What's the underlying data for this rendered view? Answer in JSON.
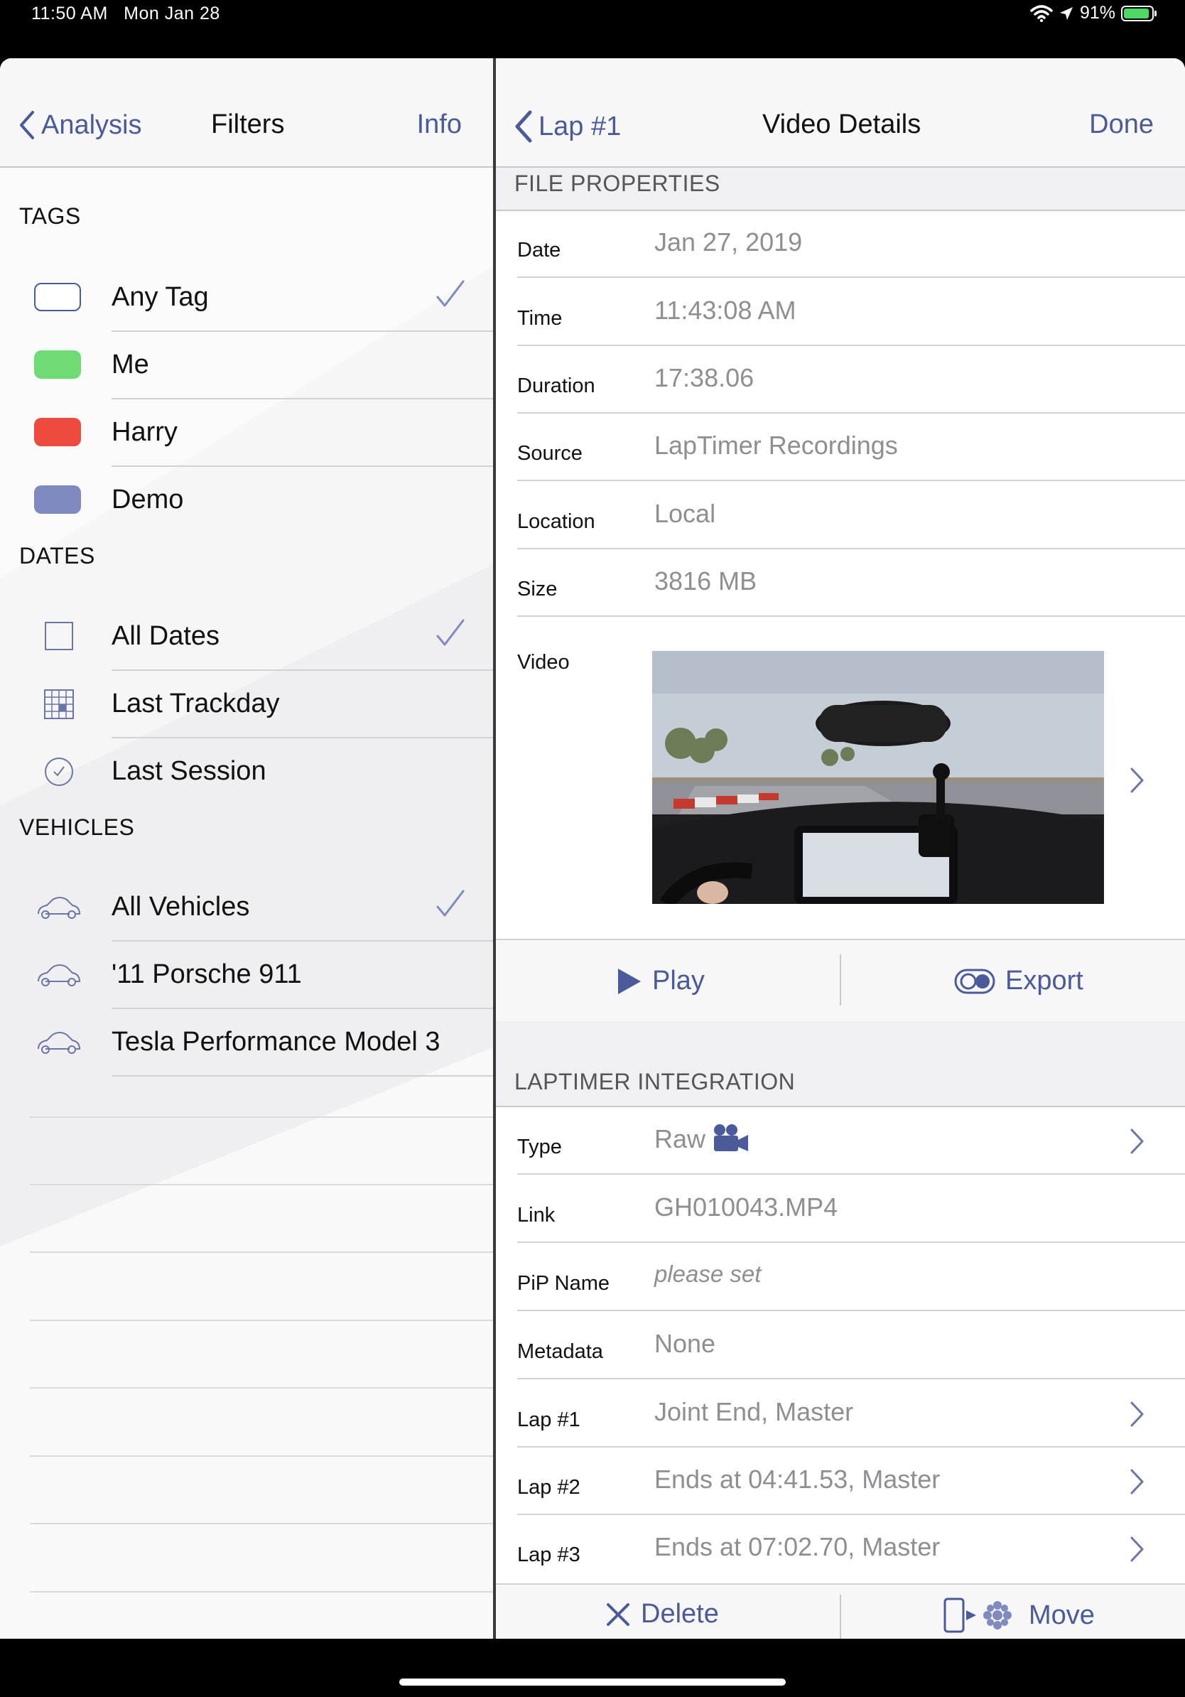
{
  "status_bar": {
    "time": "11:50 AM",
    "date": "Mon Jan 28",
    "battery": "91%",
    "battery_fraction": 0.91
  },
  "left": {
    "nav": {
      "back_label": "Analysis",
      "title": "Filters",
      "action_label": "Info"
    },
    "tags": {
      "header": "TAGS",
      "items": [
        {
          "label": "Any Tag",
          "swatch_color": "#ffffff",
          "checked": true
        },
        {
          "label": "Me",
          "swatch_color": "#6fdb75",
          "checked": false
        },
        {
          "label": "Harry",
          "swatch_color": "#ee4b3e",
          "checked": false
        },
        {
          "label": "Demo",
          "swatch_color": "#7f8bc0",
          "checked": false
        }
      ]
    },
    "dates": {
      "header": "DATES",
      "items": [
        {
          "label": "All Dates",
          "icon": "square-icon",
          "checked": true
        },
        {
          "label": "Last Trackday",
          "icon": "calendar-grid-icon",
          "checked": false
        },
        {
          "label": "Last Session",
          "icon": "clock-icon",
          "checked": false
        }
      ]
    },
    "vehicles": {
      "header": "VEHICLES",
      "items": [
        {
          "label": "All Vehicles",
          "icon": "car-icon",
          "checked": true
        },
        {
          "label": "'11 Porsche 911",
          "icon": "car-icon",
          "checked": false
        },
        {
          "label": "Tesla Performance Model 3",
          "icon": "car-icon",
          "checked": false
        }
      ]
    }
  },
  "right": {
    "nav": {
      "back_label": "Lap #1",
      "title": "Video Details",
      "action_label": "Done"
    },
    "file_properties": {
      "header": "FILE PROPERTIES",
      "items": [
        {
          "key": "Date",
          "value": "Jan 27, 2019"
        },
        {
          "key": "Time",
          "value": "11:43:08 AM"
        },
        {
          "key": "Duration",
          "value": "17:38.06"
        },
        {
          "key": "Source",
          "value": "LapTimer Recordings"
        },
        {
          "key": "Location",
          "value": "Local"
        },
        {
          "key": "Size",
          "value": "3816 MB"
        }
      ],
      "video_label": "Video"
    },
    "actions": {
      "play_label": "Play",
      "export_label": "Export"
    },
    "integration": {
      "header": "LAPTIMER INTEGRATION",
      "items": [
        {
          "key": "Type",
          "value": "Raw",
          "chevron": true,
          "icon": "video-camera-icon"
        },
        {
          "key": "Link",
          "value": "GH010043.MP4",
          "chevron": false
        },
        {
          "key": "PiP Name",
          "value": "please set",
          "chevron": false,
          "italic": true
        },
        {
          "key": "Metadata",
          "value": "None",
          "chevron": false
        },
        {
          "key": "Lap #1",
          "value": "Joint End, Master",
          "chevron": true
        },
        {
          "key": "Lap #2",
          "value": "Ends at 04:41.53, Master",
          "chevron": true
        },
        {
          "key": "Lap #3",
          "value": "Ends at 07:02.70, Master",
          "chevron": true
        }
      ]
    },
    "bottom_actions": {
      "delete_label": "Delete",
      "move_label": "Move"
    }
  },
  "colors": {
    "accent": "#4a5a9a",
    "check": "#7f8bc0"
  }
}
